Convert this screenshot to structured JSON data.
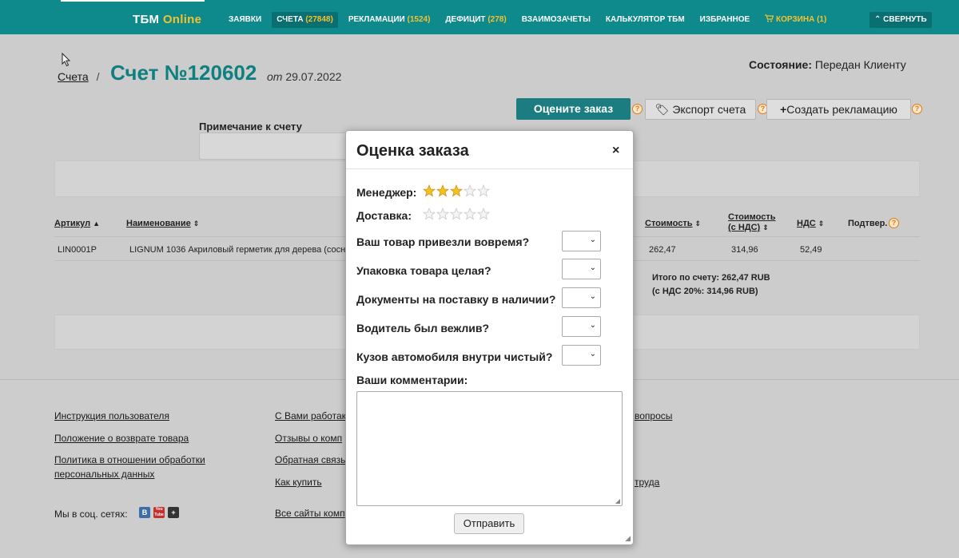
{
  "nav": {
    "logo_main": "ТБМ",
    "logo_sub": "Online",
    "items": [
      {
        "label": "ЗАЯВКИ",
        "count": ""
      },
      {
        "label": "СЧЕТА",
        "count": "(27848)"
      },
      {
        "label": "РЕКЛАМАЦИИ",
        "count": "(1524)"
      },
      {
        "label": "ДЕФИЦИТ",
        "count": "(278)"
      },
      {
        "label": "ВЗАИМОЗАЧЕТЫ",
        "count": ""
      },
      {
        "label": "КАЛЬКУЛЯТОР ТБМ",
        "count": ""
      },
      {
        "label": "ИЗБРАННОЕ",
        "count": ""
      },
      {
        "label": "КОРЗИНА",
        "count": "(1)"
      }
    ],
    "collapse_label": "СВЕРНУТЬ"
  },
  "header": {
    "breadcrumb": "Счета",
    "separator": "/",
    "title": "Счет №120602",
    "date_prefix": "от",
    "date": "29.07.2022",
    "status_label": "Состояние:",
    "status_value": "Передан Клиенту"
  },
  "actions": {
    "rate_label": "Оцените заказ",
    "export_label": "Экспорт счета",
    "claim_label": "Создать рекламацию",
    "help_glyph": "?"
  },
  "note": {
    "label": "Примечание к счету"
  },
  "table": {
    "headers": {
      "article": "Артикул",
      "name": "Наименование",
      "cost": "Стоимость",
      "cost_vat_line1": "Стоимость",
      "cost_vat_line2": "(с НДС)",
      "vat": "НДС",
      "confirm": "Подтвер."
    },
    "rows": [
      {
        "article": "LIN0001P",
        "name": "LIGNUM 1036 Акриловый герметик для дерева (сосна)",
        "cost": "262,47",
        "cost_vat": "314,96",
        "vat": "52,49"
      }
    ],
    "total_line1": "Итого по счету: 262,47 RUB",
    "total_line2": "(с НДС 20%: 314,96 RUB)"
  },
  "footer": {
    "col1": [
      "Инструкция пользователя",
      "Положение о возврате товара",
      "Политика в отношении обработки",
      "персональных данных"
    ],
    "col2": [
      "С Вами работак",
      "Отзывы о комп",
      "Обратная связь",
      "Как купить",
      "Все сайты комп"
    ],
    "col3": [
      "вопросы",
      "труда"
    ],
    "social_label": "Мы в соц. сетях:",
    "social_icons": [
      "В",
      "You Tube",
      "+"
    ]
  },
  "modal": {
    "title": "Оценка заказа",
    "close_glyph": "×",
    "manager_label": "Менеджер:",
    "manager_rating": 3,
    "delivery_label": "Доставка:",
    "delivery_rating": 0,
    "max_rating": 5,
    "questions": [
      "Ваш товар привезли вовремя?",
      "Упаковка товара целая?",
      "Документы на поставку в наличии?",
      "Водитель был вежлив?",
      "Кузов автомобиля внутри чистый?"
    ],
    "comments_label": "Ваши комментарии:",
    "submit_label": "Отправить"
  }
}
